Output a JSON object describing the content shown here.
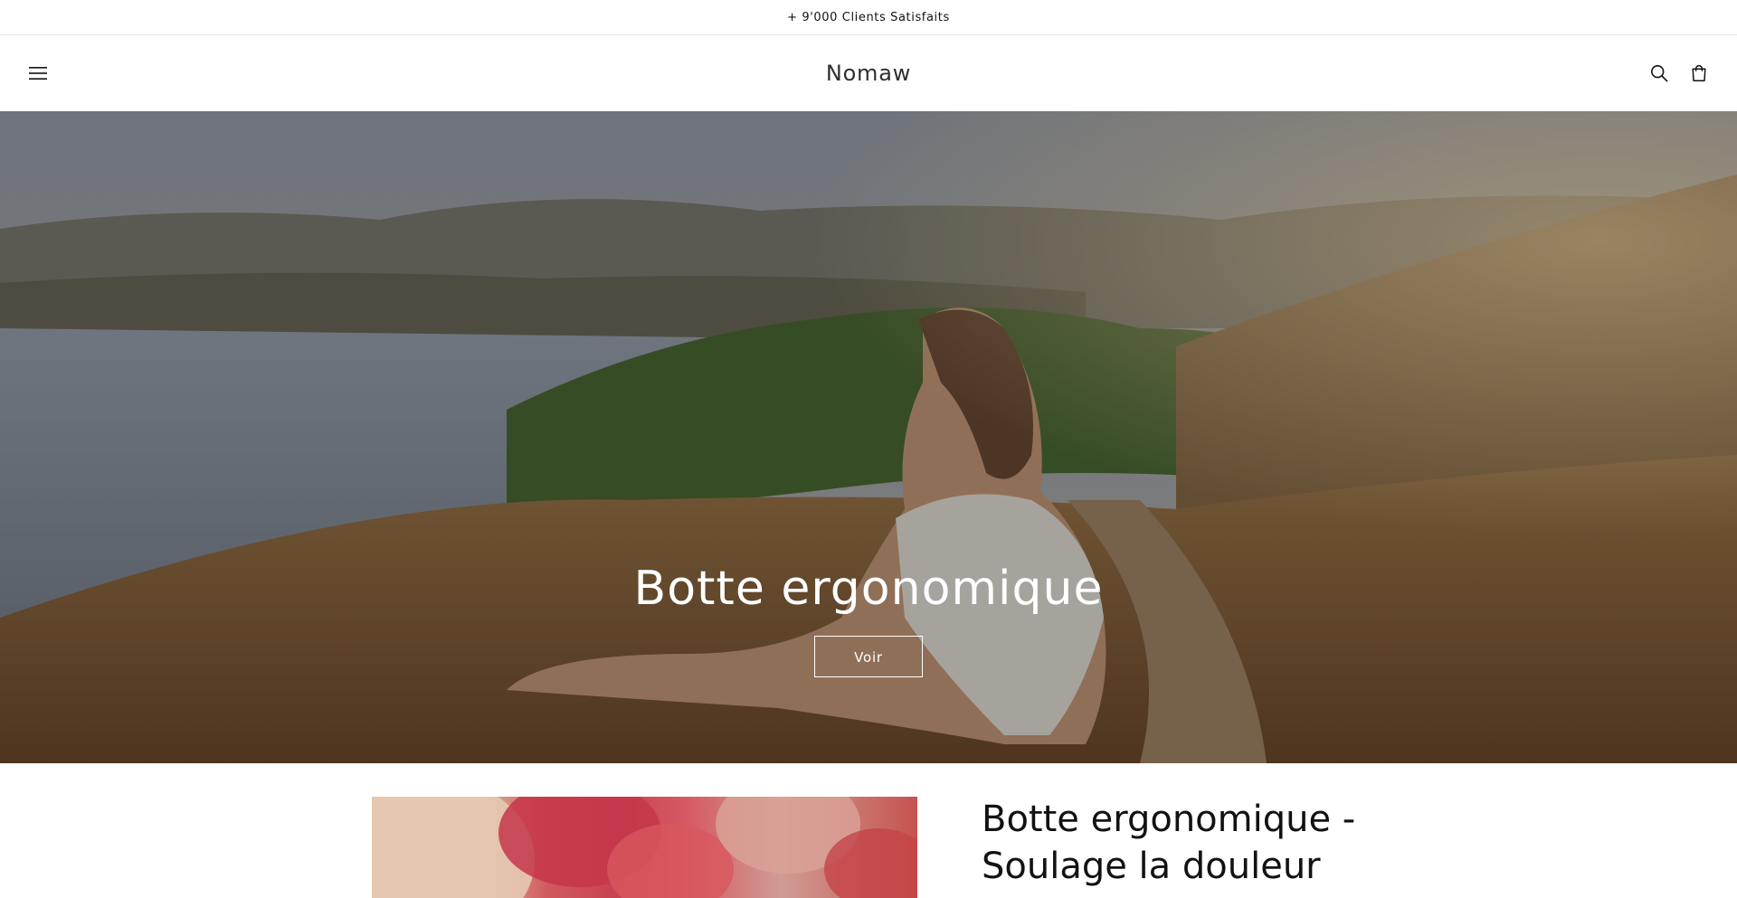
{
  "announcement": {
    "text": "+ 9'000 Clients Satisfaits"
  },
  "header": {
    "brand": "Nomaw",
    "icons": [
      "menu-icon",
      "search-icon",
      "cart-icon"
    ]
  },
  "hero": {
    "title": "Botte ergonomique",
    "button_label": "Voir"
  },
  "feature": {
    "title_line1": "Botte ergonomique -",
    "title_line2": "Soulage la douleur"
  },
  "colors": {
    "text": "#121212",
    "background": "#ffffff",
    "hero_text": "#ffffff"
  }
}
